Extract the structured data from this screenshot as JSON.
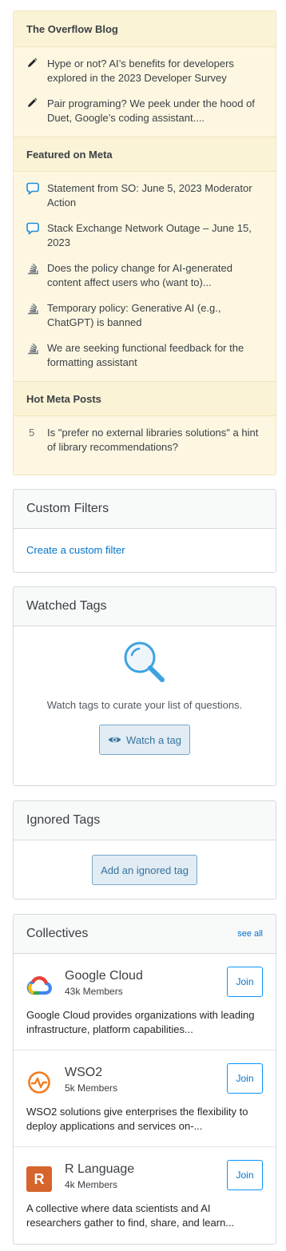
{
  "blog": {
    "overflow_title": "The Overflow Blog",
    "overflow_items": [
      {
        "icon": "pencil-icon",
        "text": "Hype or not? AI’s benefits for developers explored in the 2023 Developer Survey"
      },
      {
        "icon": "pencil-icon",
        "text": "Pair programing? We peek under the hood of Duet, Google’s coding assistant...."
      }
    ],
    "meta_title": "Featured on Meta",
    "meta_items": [
      {
        "icon": "chat-bubble-icon",
        "text": "Statement from SO: June 5, 2023 Moderator Action"
      },
      {
        "icon": "chat-bubble-icon",
        "text": "Stack Exchange Network Outage – June 15, 2023"
      },
      {
        "icon": "stack-icon",
        "text": "Does the policy change for AI-generated content affect users who (want to)..."
      },
      {
        "icon": "stack-icon",
        "text": "Temporary policy: Generative AI (e.g., ChatGPT) is banned"
      },
      {
        "icon": "stack-icon",
        "text": "We are seeking functional feedback for the formatting assistant"
      }
    ],
    "hot_title": "Hot Meta Posts",
    "hot_items": [
      {
        "count": "5",
        "text": "Is \"prefer no external libraries solutions\" a hint of library recommendations?"
      }
    ]
  },
  "custom_filters": {
    "title": "Custom Filters",
    "link": "Create a custom filter"
  },
  "watched_tags": {
    "title": "Watched Tags",
    "message": "Watch tags to curate your list of questions.",
    "button": "Watch a tag",
    "icon": "magnifier-icon"
  },
  "ignored_tags": {
    "title": "Ignored Tags",
    "button": "Add an ignored tag"
  },
  "collectives": {
    "title": "Collectives",
    "see_all": "see all",
    "join_label": "Join",
    "items": [
      {
        "name": "Google Cloud",
        "members": "43k Members",
        "desc": "Google Cloud provides organizations with leading infrastructure, platform capabilities..."
      },
      {
        "name": "WSO2",
        "members": "5k Members",
        "desc": "WSO2 solutions give enterprises the flexibility to deploy applications and services on-..."
      },
      {
        "name": "R Language",
        "logo_letter": "R",
        "members": "4k Members",
        "desc": "A collective where data scientists and AI researchers gather to find, share, and learn..."
      }
    ]
  },
  "colors": {
    "blog_bg": "#fdf7e2",
    "link": "#0074cc",
    "r_logo": "#d5652c"
  }
}
